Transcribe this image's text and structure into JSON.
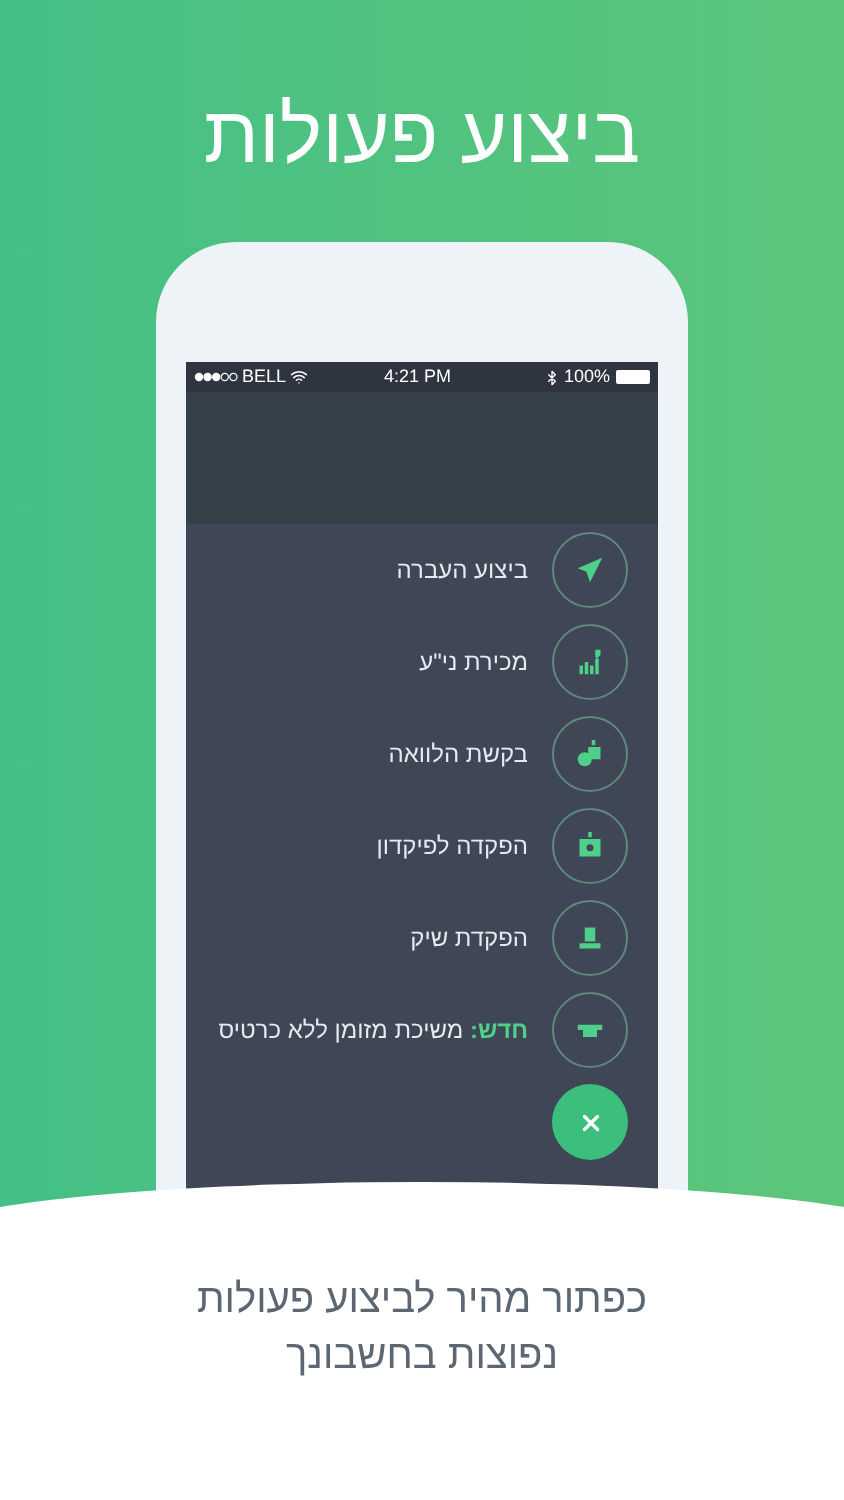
{
  "headline": "ביצוע פעולות",
  "status_bar": {
    "carrier": "BELL",
    "time": "4:21 PM",
    "battery": "100%"
  },
  "actions": [
    {
      "kind": "send",
      "label": "ביצוע העברה"
    },
    {
      "kind": "stocks",
      "label": "מכירת ני\"ע"
    },
    {
      "kind": "loan",
      "label": "בקשת הלוואה"
    },
    {
      "kind": "deposit",
      "label": "הפקדה לפיקדון"
    },
    {
      "kind": "check",
      "label": "הפקדת שיק"
    },
    {
      "kind": "cash",
      "tag": "חדש:",
      "label": "משיכת מזומן ללא כרטיס"
    }
  ],
  "caption": "כפתור מהיר לביצוע פעולות נפוצות בחשבונך"
}
